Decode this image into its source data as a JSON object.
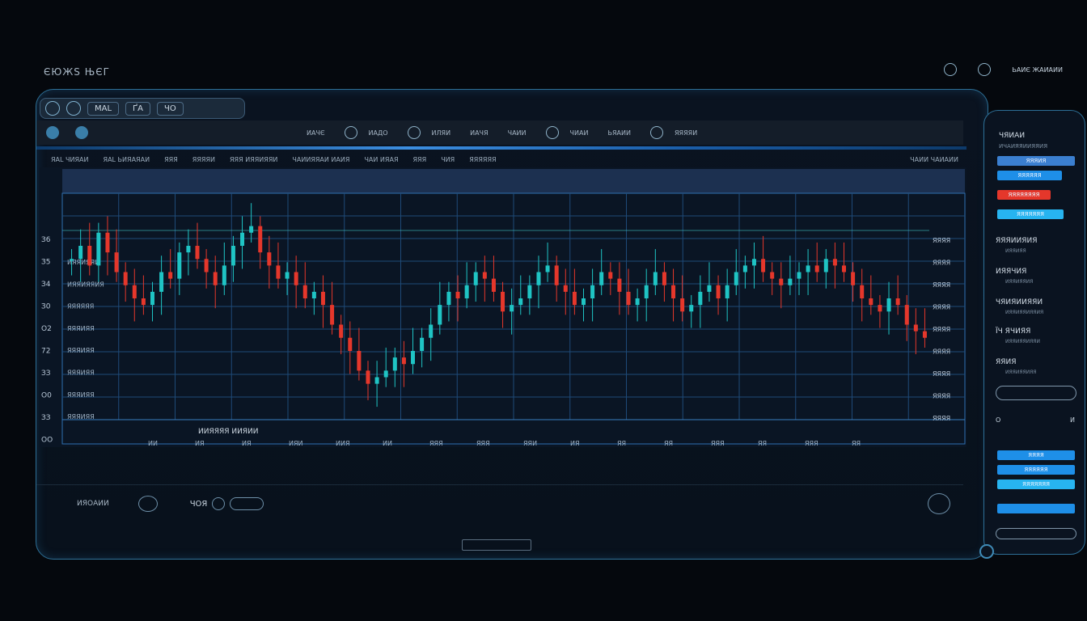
{
  "app": {
    "brand": "ЄЮЖS ЊЄГ"
  },
  "top_right": {
    "label": "ЬАИЄ\nЖАИАИИ"
  },
  "tabs": [
    {
      "label": "МАL"
    },
    {
      "label": "ҐА"
    },
    {
      "label": "ЧО"
    }
  ],
  "toolbar": {
    "items": [
      "ИАЧЄ",
      "ИАДО",
      "ИЛЯИ",
      "ИАЧЯ",
      "ЧАИИ",
      "ЧИАИ",
      "ЬЯАИИ",
      "ЯЯЯЯИ"
    ]
  },
  "infobar": {
    "left": [
      "ЯАL ЧИЯАИ",
      "ЯАL ЬИЯАЯАИ",
      "ЯЯЯ",
      "ЯЯЯЯИ",
      "ЯЯЯ ИЯЯИЯЯИ",
      "ЧАИИЯЯАИ ИАИЯ",
      "ЧАИ ИЯАЯ",
      "ЯЯЯ",
      "ЧИЯ",
      "ЯЯЯЯЯЯ"
    ],
    "right": "ЧАИИ ЧАИАИИ"
  },
  "footer": {
    "left_label": "ИЯОАИИ",
    "mid_label": "ЧОЯ"
  },
  "panel": {
    "title": "ЧЯИАИ",
    "subtitle": "ИЧАИЯЯИИЯЯИЯ",
    "buttons": [
      "ЯЯЯИЯ",
      "ЯЯЯЯЯЯ",
      "ЯЯЯЯЯЯЯЯ",
      "ЯЯЯЯЯЯЯ"
    ],
    "items": [
      {
        "label": "ЯЯЯИИЯИЯ",
        "sub": "ИЯЯИЯЯ"
      },
      {
        "label": "ИЯЯЧИЯ",
        "sub": "ИЯЯИЯЯИЯ"
      },
      {
        "label": "ЧЯИЯИИЯЯИ",
        "sub": "ИЯЯИЯЯИЯЯИЯ"
      },
      {
        "label": "ЇЧ ЯЧИЯЯ",
        "sub": "ИЯЯИЯЯИЯЯИ"
      },
      {
        "label": "ЯЯИЯ",
        "sub": "ИЯЯИЯЯИЯЯ"
      }
    ],
    "range": {
      "min": "О",
      "max": "И"
    },
    "bottom_buttons": [
      "ЯЯЯЯ",
      "ЯЯЯЯЯЯ",
      "ЯЯЯЯЯЯЯ"
    ]
  },
  "chart_data": {
    "type": "candlestick",
    "y_ticks": [
      "З6",
      "З5",
      "З4",
      "З0",
      "О2",
      "72",
      "ЗЗ",
      "О0",
      "ЗЗ",
      "ОО"
    ],
    "x_ticks": [
      "ИИ",
      "ИЯ",
      "ИЯ",
      "ИЯИ",
      "ИИЯ",
      "ИИ",
      "ЯЯЯ",
      "ЯЯЯ",
      "ЯЯИ",
      "ИЯ",
      "ЯЯ",
      "ЯЯ",
      "ЯЯЯ",
      "ЯЯ",
      "ЯЯЯ",
      "ЯЯ"
    ],
    "left_labels": [
      "ИЯЯИЯЯИ",
      "ИЯЯИЯЯИЯ",
      "ЯЯЯЯЯЯ",
      "ЯЯЯИЯЯ",
      "ЯЯЯИЯЯ",
      "ЯЯЯИЯЯ",
      "ЯЯЯИЯЯ",
      "ЯЯЯИЯЯ"
    ],
    "right_labels": [
      "ЯЯЯЯ",
      "ЯЯЯЯ",
      "ЯЯЯЯ",
      "ЯЯЯЯ",
      "ЯЯЯЯ",
      "ЯЯЯЯ",
      "ЯЯЯЯ",
      "ЯЯЯЯ",
      "ЯЯЯЯ"
    ],
    "bottom_label": "ИИЯЯЯЯ ИИЯИИ",
    "grid": true,
    "up_color": "#1fc4c4",
    "down_color": "#e5372b",
    "series_close": [
      62,
      64,
      61,
      66,
      63,
      60,
      58,
      56,
      55,
      57,
      60,
      59,
      63,
      64,
      62,
      60,
      58,
      61,
      64,
      66,
      67,
      63,
      61,
      59,
      60,
      58,
      56,
      57,
      55,
      52,
      50,
      48,
      45,
      43,
      44,
      45,
      47,
      46,
      48,
      50,
      52,
      55,
      57,
      56,
      58,
      60,
      59,
      57,
      54,
      55,
      56,
      58,
      60,
      61,
      58,
      57,
      55,
      56,
      58,
      60,
      59,
      57,
      55,
      56,
      58,
      60,
      58,
      56,
      54,
      55,
      57,
      58,
      56,
      58,
      60,
      61,
      62,
      60,
      59,
      58,
      59,
      60,
      61,
      60,
      62,
      61,
      60,
      58,
      56,
      55,
      54,
      56,
      55,
      52,
      51,
      50
    ]
  }
}
